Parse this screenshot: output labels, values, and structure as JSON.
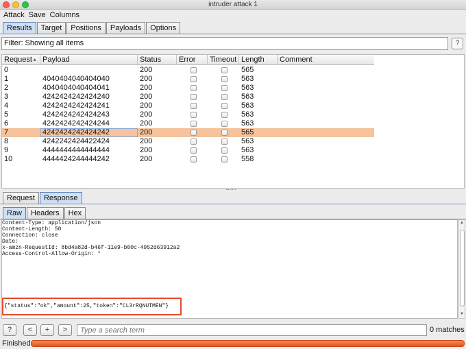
{
  "window": {
    "title": "intruder attack 1"
  },
  "menu": [
    "Attack",
    "Save",
    "Columns"
  ],
  "top_tabs": [
    {
      "label": "Results",
      "active": true
    },
    {
      "label": "Target",
      "active": false
    },
    {
      "label": "Positions",
      "active": false
    },
    {
      "label": "Payloads",
      "active": false
    },
    {
      "label": "Options",
      "active": false
    }
  ],
  "filter": {
    "text": "Filter: Showing all items",
    "help": "?"
  },
  "table": {
    "columns": [
      "Request",
      "Payload",
      "Status",
      "Error",
      "Timeout",
      "Length",
      "Comment"
    ],
    "sort_indicator": "▲",
    "selected_request": "7",
    "rows": [
      {
        "request": "0",
        "payload": "",
        "status": "200",
        "error": false,
        "timeout": false,
        "length": "565",
        "comment": ""
      },
      {
        "request": "1",
        "payload": "4040404040404040",
        "status": "200",
        "error": false,
        "timeout": false,
        "length": "563",
        "comment": ""
      },
      {
        "request": "2",
        "payload": "4040404040404041",
        "status": "200",
        "error": false,
        "timeout": false,
        "length": "563",
        "comment": ""
      },
      {
        "request": "3",
        "payload": "4242424242424240",
        "status": "200",
        "error": false,
        "timeout": false,
        "length": "563",
        "comment": ""
      },
      {
        "request": "4",
        "payload": "4242424242424241",
        "status": "200",
        "error": false,
        "timeout": false,
        "length": "563",
        "comment": ""
      },
      {
        "request": "5",
        "payload": "4242424242424243",
        "status": "200",
        "error": false,
        "timeout": false,
        "length": "563",
        "comment": ""
      },
      {
        "request": "6",
        "payload": "4242424242424244",
        "status": "200",
        "error": false,
        "timeout": false,
        "length": "563",
        "comment": ""
      },
      {
        "request": "7",
        "payload": "4242424242424242",
        "status": "200",
        "error": false,
        "timeout": false,
        "length": "565",
        "comment": ""
      },
      {
        "request": "8",
        "payload": "4242242424422424",
        "status": "200",
        "error": false,
        "timeout": false,
        "length": "563",
        "comment": ""
      },
      {
        "request": "9",
        "payload": "4444444444444444",
        "status": "200",
        "error": false,
        "timeout": false,
        "length": "563",
        "comment": ""
      },
      {
        "request": "10",
        "payload": "4444424244444242",
        "status": "200",
        "error": false,
        "timeout": false,
        "length": "558",
        "comment": ""
      }
    ]
  },
  "detail_tabs": [
    {
      "label": "Request",
      "active": false
    },
    {
      "label": "Response",
      "active": true
    }
  ],
  "view_tabs": [
    {
      "label": "Raw",
      "active": true
    },
    {
      "label": "Headers",
      "active": false
    },
    {
      "label": "Hex",
      "active": false
    }
  ],
  "response": {
    "headers": [
      "Content-Type: application/json",
      "Content-Length: 50",
      "Connection: close",
      "Date:",
      "x-amzn-RequestId: 8bd4a82d-b46f-11e9-b00c-4952d63912a2",
      "Access-Control-Allow-Origin: *"
    ],
    "body": "{\"status\":\"ok\",\"amount\":25,\"token\":\"CL3rRQNUTMEN\"}"
  },
  "search": {
    "buttons": [
      "?",
      "<",
      "+",
      ">"
    ],
    "placeholder": "Type a search term",
    "matches": "0 matches"
  },
  "status_bar": {
    "text": "Finished",
    "progress": 1.0
  },
  "colors": {
    "selected_row": "#f6c39c",
    "highlight_box": "#e64a2c",
    "progress": "#e2561c",
    "active_tab": "#cfe0f5"
  }
}
